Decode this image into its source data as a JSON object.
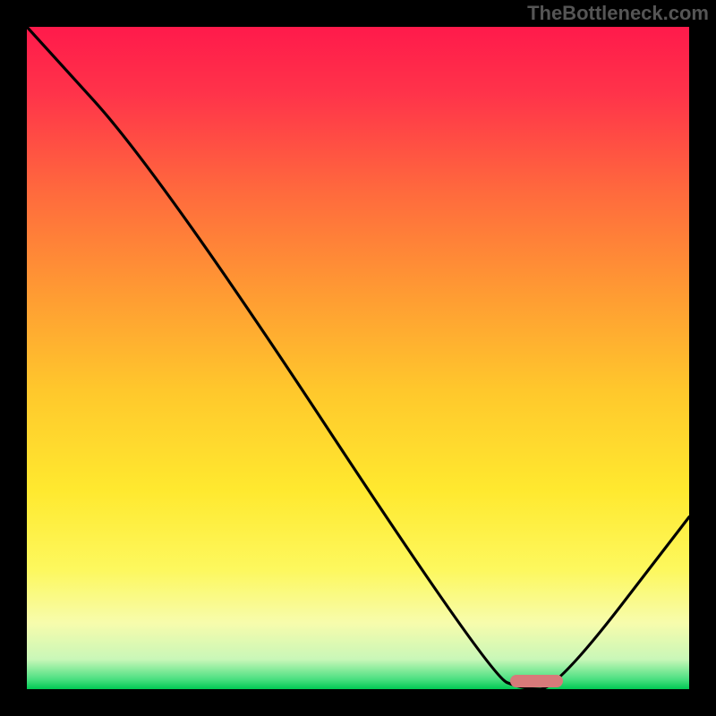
{
  "watermark": "TheBottleneck.com",
  "chart_data": {
    "type": "line",
    "title": "",
    "xlabel": "",
    "ylabel": "",
    "xlim": [
      0,
      100
    ],
    "ylim": [
      0,
      100
    ],
    "series": [
      {
        "name": "curve",
        "x": [
          0,
          20,
          70,
          75,
          80,
          100
        ],
        "y": [
          100,
          78,
          2,
          0,
          0,
          26
        ]
      }
    ],
    "marker": {
      "x_start": 73,
      "x_end": 81,
      "y": 1.2
    },
    "gradient_stops": [
      {
        "offset": 0.0,
        "color": "#ff1a4b"
      },
      {
        "offset": 0.1,
        "color": "#ff334a"
      },
      {
        "offset": 0.25,
        "color": "#ff6a3d"
      },
      {
        "offset": 0.4,
        "color": "#ff9a33"
      },
      {
        "offset": 0.55,
        "color": "#ffc82c"
      },
      {
        "offset": 0.7,
        "color": "#ffe92f"
      },
      {
        "offset": 0.82,
        "color": "#fdf85e"
      },
      {
        "offset": 0.9,
        "color": "#f7fcac"
      },
      {
        "offset": 0.955,
        "color": "#c9f7b8"
      },
      {
        "offset": 0.985,
        "color": "#4be081"
      },
      {
        "offset": 1.0,
        "color": "#00c853"
      }
    ]
  }
}
